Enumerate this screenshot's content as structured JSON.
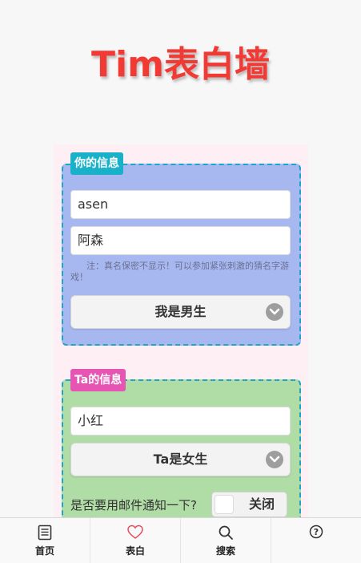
{
  "title": "Tim表白墙",
  "colors": {
    "title": "#f23a35",
    "accent_blue": "#a7b8f0",
    "accent_green": "#b0dca6"
  },
  "your_info": {
    "badge": "你的信息",
    "email_value": "asen",
    "nickname_value": "阿森",
    "note": "注：真名保密不显示！可以参加紧张刺激的猜名字游戏！",
    "gender_selected": "我是男生"
  },
  "ta_info": {
    "badge": "Ta的信息",
    "name_value": "小红",
    "gender_selected": "Ta是女生",
    "mail_notify_label": "是否要用邮件通知一下?",
    "mail_toggle": "关闭"
  },
  "tabbar": {
    "items": [
      {
        "label": "首页",
        "icon": "document-icon"
      },
      {
        "label": "表白",
        "icon": "heart-icon"
      },
      {
        "label": "搜索",
        "icon": "search-icon"
      },
      {
        "label": "",
        "icon": "help-icon"
      }
    ]
  }
}
